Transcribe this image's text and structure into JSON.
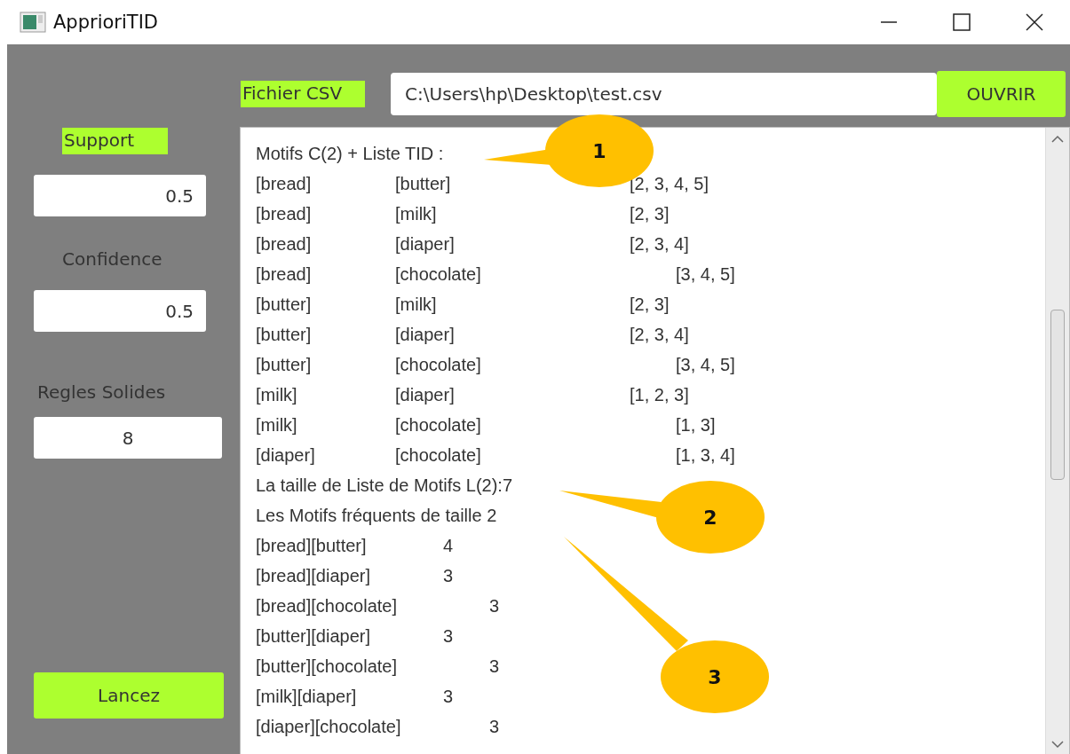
{
  "window": {
    "title": "ApprioriTID"
  },
  "left_panel": {
    "support_label": "Support",
    "support_value": "0.5",
    "confidence_label": "Confidence",
    "confidence_value": "0.5",
    "rules_label": "Regles Solides",
    "rules_value": "8",
    "run_button": "Lancez"
  },
  "file_bar": {
    "label": "Fichier CSV",
    "path": "C:\\Users\\hp\\Desktop\\test.csv",
    "open_button": "OUVRIR"
  },
  "output": {
    "lines": [
      {
        "kind": "heading",
        "text": "Motifs C(2) + Liste TID :"
      },
      {
        "kind": "candidate",
        "items": [
          "[bread]",
          "[butter]"
        ],
        "tids": "[2, 3, 4, 5]"
      },
      {
        "kind": "candidate",
        "items": [
          "[bread]",
          "[milk]"
        ],
        "tids": "[2, 3]"
      },
      {
        "kind": "candidate",
        "items": [
          "[bread]",
          "[diaper]"
        ],
        "tids": "[2, 3, 4]"
      },
      {
        "kind": "candidate",
        "items": [
          "[bread]",
          "[chocolate]"
        ],
        "tids": "[3, 4, 5]"
      },
      {
        "kind": "candidate",
        "items": [
          "[butter]",
          "[milk]"
        ],
        "tids": "[2, 3]"
      },
      {
        "kind": "candidate",
        "items": [
          "[butter]",
          "[diaper]"
        ],
        "tids": "[2, 3, 4]"
      },
      {
        "kind": "candidate",
        "items": [
          "[butter]",
          "[chocolate]"
        ],
        "tids": "[3, 4, 5]"
      },
      {
        "kind": "candidate",
        "items": [
          "[milk]",
          "[diaper]"
        ],
        "tids": "[1, 2, 3]"
      },
      {
        "kind": "candidate",
        "items": [
          "[milk]",
          "[chocolate]"
        ],
        "tids": "[1, 3]"
      },
      {
        "kind": "candidate",
        "items": [
          "[diaper]",
          "[chocolate]"
        ],
        "tids": "[1, 3, 4]"
      },
      {
        "kind": "heading",
        "text": "La taille de Liste de Motifs L(2):7"
      },
      {
        "kind": "heading",
        "text": "Les Motifs fréquents de taille 2"
      },
      {
        "kind": "frequent",
        "pattern": "[bread][butter]",
        "count": "4"
      },
      {
        "kind": "frequent",
        "pattern": "[bread][diaper]",
        "count": "3"
      },
      {
        "kind": "frequent",
        "pattern": "[bread][chocolate]",
        "count": "3"
      },
      {
        "kind": "frequent",
        "pattern": "[butter][diaper]",
        "count": "3"
      },
      {
        "kind": "frequent",
        "pattern": "[butter][chocolate]",
        "count": "3"
      },
      {
        "kind": "frequent",
        "pattern": "[milk][diaper]",
        "count": "3"
      },
      {
        "kind": "frequent",
        "pattern": "[diaper][chocolate]",
        "count": "3"
      }
    ]
  },
  "callouts": [
    {
      "label": "1"
    },
    {
      "label": "2"
    },
    {
      "label": "3"
    }
  ]
}
